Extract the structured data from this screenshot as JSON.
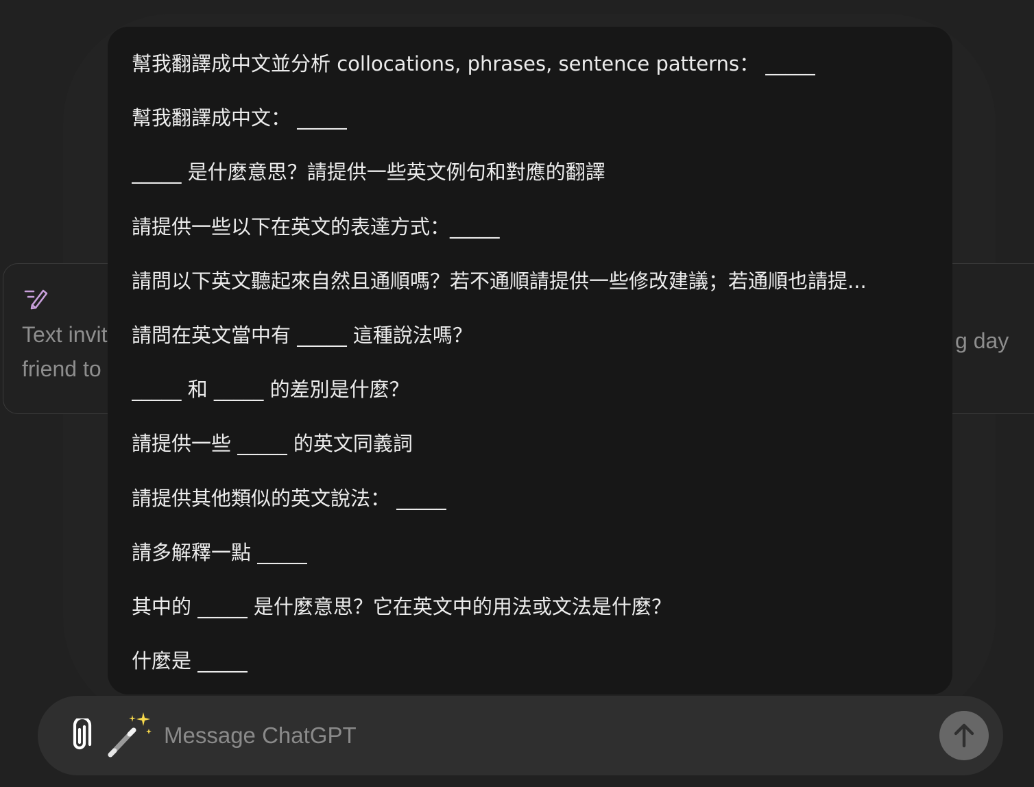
{
  "suggestion": {
    "icon": "pen-icon",
    "text_left": "Text invit\nfriend to",
    "text_right": "g day"
  },
  "prompts": [
    "幫我翻譯成中文並分析 collocations, phrases, sentence patterns： _____",
    "幫我翻譯成中文： _____",
    "_____ 是什麼意思？請提供一些英文例句和對應的翻譯",
    "請提供一些以下在英文的表達方式：_____",
    "請問以下英文聽起來自然且通順嗎？若不通順請提供一些修改建議；若通順也請提...",
    "請問在英文當中有 _____ 這種說法嗎？",
    "_____ 和 _____ 的差別是什麼？",
    "請提供一些 _____ 的英文同義詞",
    "請提供其他類似的英文說法： _____",
    "請多解釋一點 _____",
    "其中的 _____ 是什麼意思？它在英文中的用法或文法是什麼？",
    "什麼是 _____"
  ],
  "composer": {
    "placeholder": "Message ChatGPT",
    "attach_icon": "paperclip-icon",
    "wand_icon": "magic-wand-icon",
    "send_icon": "arrow-up-icon"
  },
  "colors": {
    "background": "#212121",
    "popover": "#171717",
    "composer": "#2f2f2f",
    "send_button": "#676767",
    "text": "#ececec",
    "muted_text": "#8e8e8e",
    "accent_icon": "#c9a0dc"
  }
}
